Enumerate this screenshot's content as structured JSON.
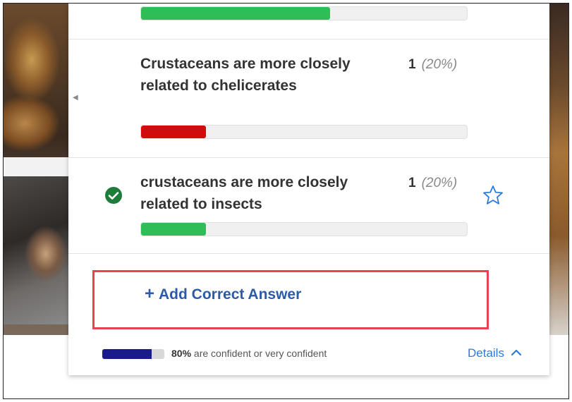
{
  "answers": [
    {
      "text": "",
      "count": "",
      "percent": "",
      "fraction": 0.58,
      "bar_color": "#2ebd56",
      "correct": false
    },
    {
      "text": "Crustaceans are more closely related to chelicerates",
      "count": "1",
      "percent": "(20%)",
      "fraction": 0.2,
      "bar_color": "#d10c0c",
      "correct": false
    },
    {
      "text": "crustaceans are more closely related to insects",
      "count": "1",
      "percent": "(20%)",
      "fraction": 0.2,
      "bar_color": "#2ebd56",
      "correct": true
    }
  ],
  "add_correct_answer": {
    "plus": "+",
    "label": "Add Correct Answer"
  },
  "confidence": {
    "fraction": 0.8,
    "percent_label": "80%",
    "text": " are confident or very confident"
  },
  "details": {
    "label": "Details",
    "chevron": "^"
  },
  "icons": {
    "correct": "check-circle-icon",
    "favorite": "star-outline-icon",
    "collapse": "chevron-left-icon"
  },
  "colors": {
    "accent_blue": "#2c5ba8",
    "highlight_red": "#e8414f",
    "confidence_navy": "#1a1a8c"
  }
}
